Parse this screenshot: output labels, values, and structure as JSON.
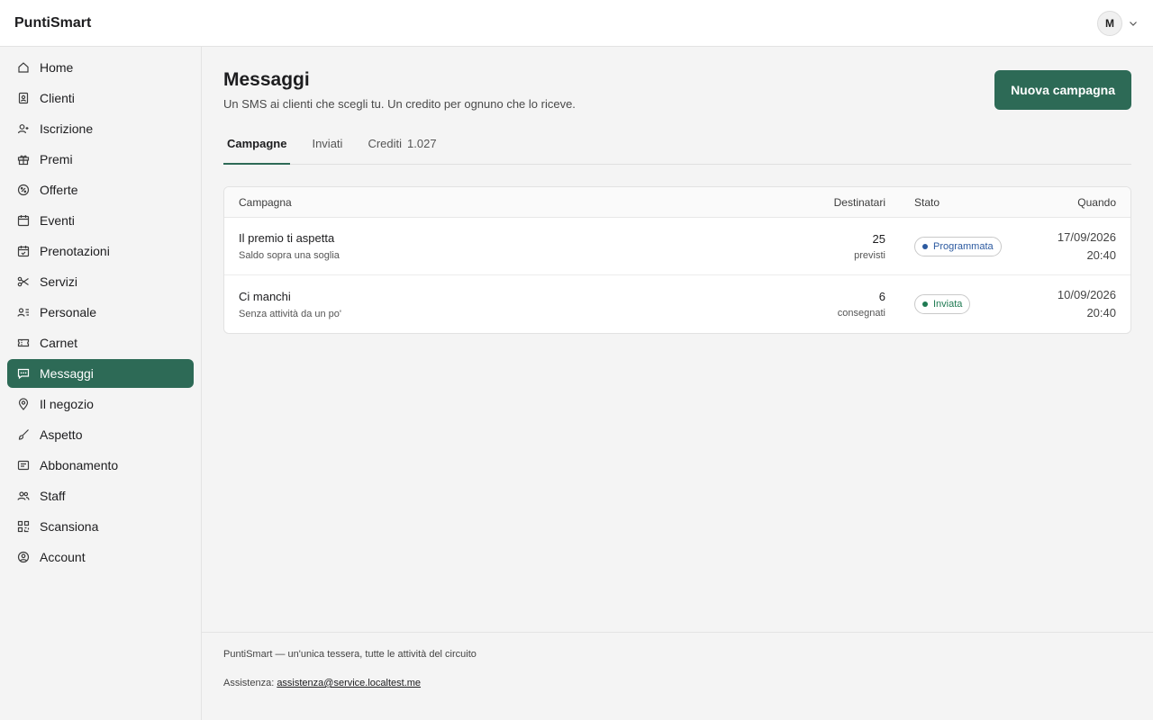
{
  "app": {
    "brand": "PuntiSmart",
    "user_initial": "M"
  },
  "sidebar": {
    "items": [
      {
        "label": "Home",
        "icon": "home-icon"
      },
      {
        "label": "Clienti",
        "icon": "contacts-icon"
      },
      {
        "label": "Iscrizione",
        "icon": "user-add-icon"
      },
      {
        "label": "Premi",
        "icon": "gift-icon"
      },
      {
        "label": "Offerte",
        "icon": "percent-badge-icon"
      },
      {
        "label": "Eventi",
        "icon": "calendar-icon"
      },
      {
        "label": "Prenotazioni",
        "icon": "calendar-check-icon"
      },
      {
        "label": "Servizi",
        "icon": "scissors-icon"
      },
      {
        "label": "Personale",
        "icon": "user-list-icon"
      },
      {
        "label": "Carnet",
        "icon": "ticket-icon"
      },
      {
        "label": "Messaggi",
        "icon": "message-icon",
        "active": true
      },
      {
        "label": "Il negozio",
        "icon": "map-pin-icon"
      },
      {
        "label": "Aspetto",
        "icon": "brush-icon"
      },
      {
        "label": "Abbonamento",
        "icon": "receipt-icon"
      },
      {
        "label": "Staff",
        "icon": "users-icon"
      },
      {
        "label": "Scansiona",
        "icon": "qr-code-icon"
      },
      {
        "label": "Account",
        "icon": "account-circle-icon"
      }
    ]
  },
  "main": {
    "title": "Messaggi",
    "subtitle": "Un SMS ai clienti che scegli tu. Un credito per ognuno che lo riceve.",
    "new_campaign_label": "Nuova campagna",
    "tabs": [
      {
        "label": "Campagne",
        "active": true
      },
      {
        "label": "Inviati"
      },
      {
        "label": "Crediti",
        "count": "1.027"
      }
    ],
    "table": {
      "headers": {
        "name": "Campagna",
        "recipients": "Destinatari",
        "state": "Stato",
        "when": "Quando"
      },
      "rows": [
        {
          "name": "Il premio ti aspetta",
          "desc": "Saldo sopra una soglia",
          "count": "25",
          "count_unit": "previsti",
          "state": "Programmata",
          "state_color": "#2c5aa0",
          "date": "17/09/2026",
          "time": "20:40"
        },
        {
          "name": "Ci manchi",
          "desc": "Senza attività da un po'",
          "count": "6",
          "count_unit": "consegnati",
          "state": "Inviata",
          "state_color": "#1f7a52",
          "date": "10/09/2026",
          "time": "20:40"
        }
      ]
    }
  },
  "footer": {
    "tagline": "PuntiSmart — un'unica tessera, tutte le attività del circuito",
    "support_label": "Assistenza:",
    "support_email": "assistenza@service.localtest.me"
  },
  "colors": {
    "accent": "#2d6a56",
    "background": "#f4f4f4"
  }
}
